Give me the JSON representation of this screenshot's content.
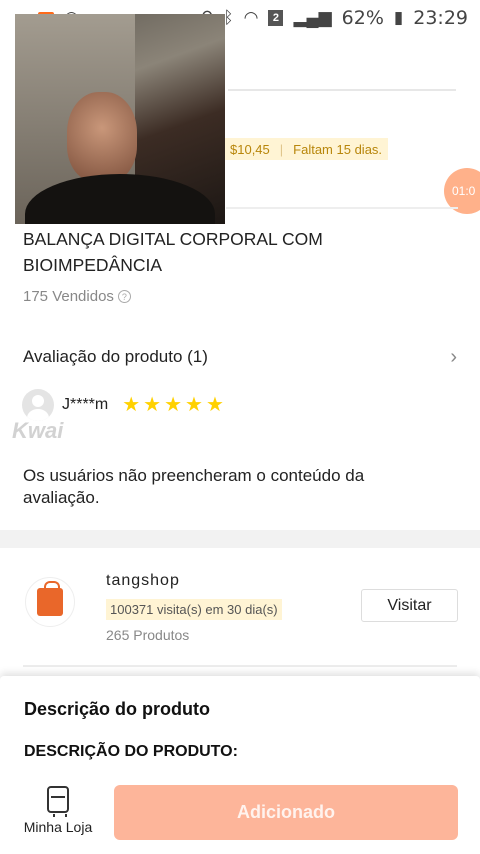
{
  "status_bar": {
    "battery_percent": "62%",
    "time": "23:29",
    "notification_count": "2",
    "icons": [
      "record-icon",
      "camera-icon",
      "cast-icon",
      "location-icon",
      "bluetooth-icon",
      "wifi-icon",
      "signal-icon",
      "battery-icon"
    ]
  },
  "banner": {
    "price": "$10,45",
    "days_left": "Faltam 15 dias.",
    "timer": "01:0"
  },
  "product": {
    "title_line1": "BALANÇA DIGITAL CORPORAL COM",
    "title_line2": "BIOIMPEDÂNCIA",
    "sold": "175 Vendidos"
  },
  "reviews": {
    "header": "Avaliação do produto (1)",
    "reviewer": "J****m",
    "rating": 5,
    "text_line1": "Os usuários não preencheram o conteúdo da",
    "text_line2": "avaliação.",
    "watermark": "Kwai"
  },
  "shop": {
    "name": "tangshop",
    "visits": "100371 visita(s) em 30 dia(s)",
    "products": "265 Produtos",
    "visit_button": "Visitar"
  },
  "sheet": {
    "description_title": "Descrição do produto",
    "description_subtitle": "DESCRIÇÃO DO PRODUTO:",
    "store_tab": "Minha Loja",
    "add_button": "Adicionado"
  },
  "colors": {
    "accent": "#fdb59a",
    "timer": "#ffb18a",
    "star": "#ffd100",
    "chip_bg": "#fff4d4"
  }
}
